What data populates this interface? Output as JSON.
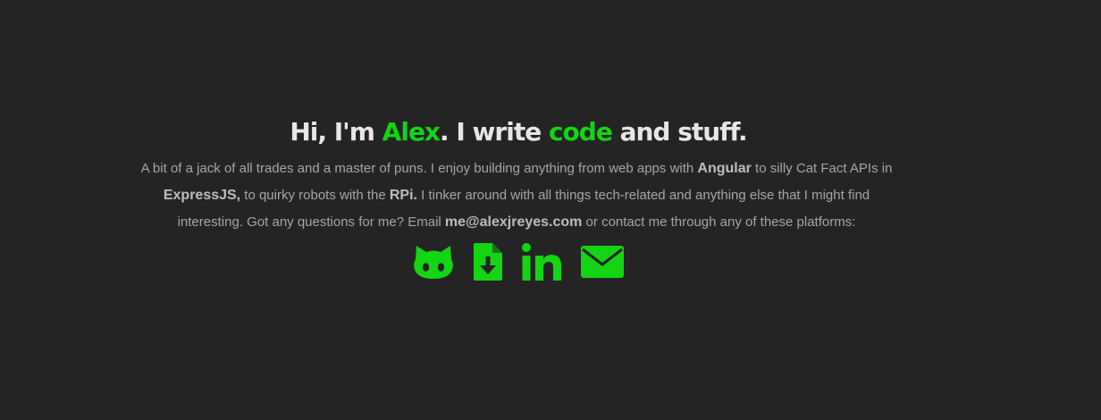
{
  "colors": {
    "background": "#242424",
    "accent": "#13d513",
    "heading": "#e6e6e6",
    "body_text": "#a6a6a6",
    "emphasis": "#bdbdbd"
  },
  "headline": {
    "part1": "Hi, I'm ",
    "name": "Alex",
    "part2": ". I write ",
    "code": "code",
    "part3": " and stuff."
  },
  "bio": {
    "t1": "A bit of a jack of all trades and a master of puns. I enjoy building anything from web apps with ",
    "angular": "Angular",
    "t2": " to silly Cat Fact APIs in ",
    "expressjs": "ExpressJS,",
    "t3": " to quirky robots with the ",
    "rpi": "RPi.",
    "t4": " I tinker around with all things tech-related and anything else that I might find interesting. Got any questions for me? Email ",
    "email": "me@alexjreyes.com",
    "t5": " or contact me through any of these platforms:"
  },
  "links": [
    {
      "icon": "github-icon"
    },
    {
      "icon": "resume-download-icon"
    },
    {
      "icon": "linkedin-icon"
    },
    {
      "icon": "email-icon"
    }
  ]
}
